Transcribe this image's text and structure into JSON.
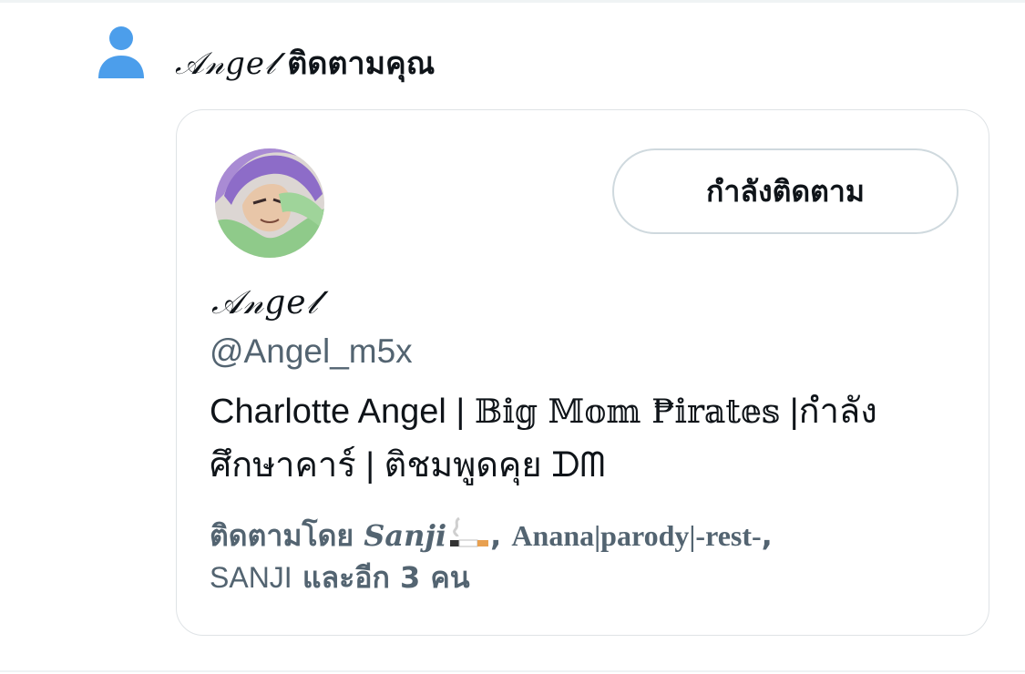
{
  "notification": {
    "icon": "person-icon",
    "actor_name": "𝒜𝓃𝑔𝑒𝓁",
    "action_text": "ติดตามคุณ"
  },
  "user_card": {
    "avatar": "avatar",
    "follow_button_label": "กำลังติดตาม",
    "display_name": "𝒜𝓃𝑔𝑒𝓁",
    "handle": "@Angel_m5x",
    "bio": {
      "part1": "Charlotte Angel | ",
      "styled": "𝔹𝕚𝕘 𝕄𝕠𝕞 ₱𝕚𝕣𝕒𝕥𝕖𝕤",
      "part2": " |กำลังศึกษาคาร์ | ติชมพูดคุย ᗪᗰ"
    },
    "followed_by": {
      "label": "ติดตามโดย ",
      "follower1": "Sanji",
      "follower1_emoji": "cigarette-icon",
      "sep1": ", ",
      "follower2": "Anana|parody|-rest-",
      "sep2": ",",
      "follower3": "SANJI",
      "rest": " และอีก 3 คน"
    }
  },
  "colors": {
    "icon_blue": "#4c9eeb",
    "secondary_text": "#536471",
    "border": "#dfe3e6",
    "button_border": "#cfd9de"
  }
}
